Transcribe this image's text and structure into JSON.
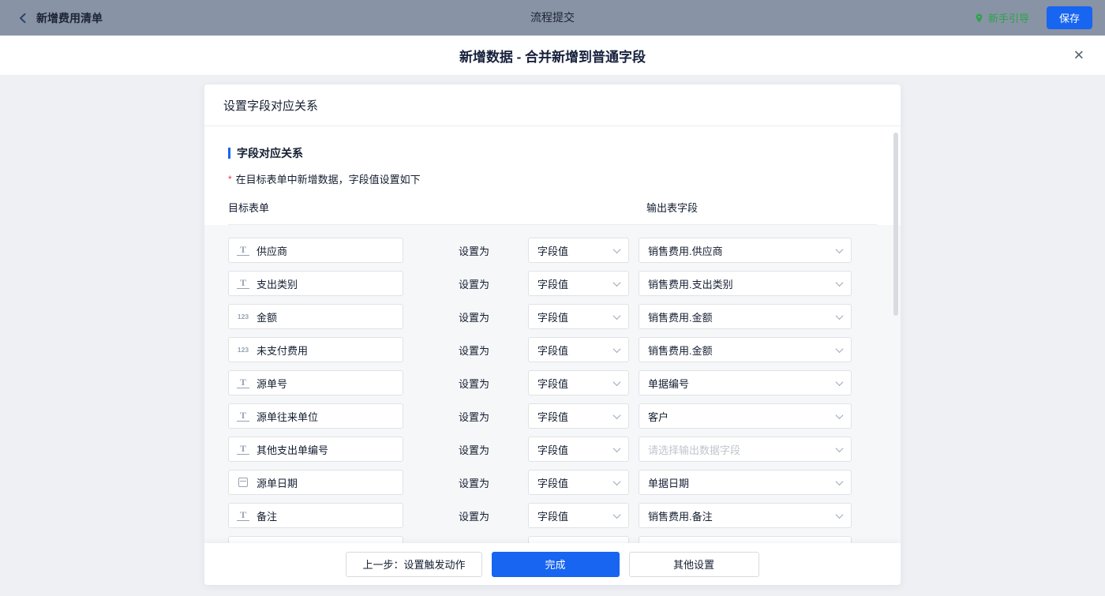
{
  "topbar": {
    "title": "新增费用清单",
    "center_title": "流程提交",
    "guide": "新手引导",
    "save": "保存"
  },
  "modal": {
    "title": "新增数据 - 合并新增到普通字段",
    "close": "✕"
  },
  "panel": {
    "header": "设置字段对应关系",
    "section_title": "字段对应关系",
    "hint_mark": "*",
    "hint": "在目标表单中新增数据，字段值设置如下",
    "columns": {
      "target": "目标表单",
      "output": "输出表字段"
    },
    "set_as_label": "设置为",
    "rows": [
      {
        "icon": "text-field-icon",
        "type": "text",
        "glyph": "T",
        "field": "供应商",
        "mode": "字段值",
        "output": "销售费用.供应商",
        "is_placeholder": false
      },
      {
        "icon": "text-field-icon",
        "type": "text",
        "glyph": "T",
        "field": "支出类别",
        "mode": "字段值",
        "output": "销售费用.支出类别",
        "is_placeholder": false
      },
      {
        "icon": "number-field-icon",
        "type": "number",
        "glyph": "123",
        "field": "金额",
        "mode": "字段值",
        "output": "销售费用.金额",
        "is_placeholder": false
      },
      {
        "icon": "number-field-icon",
        "type": "number",
        "glyph": "123",
        "field": "未支付费用",
        "mode": "字段值",
        "output": "销售费用.金额",
        "is_placeholder": false
      },
      {
        "icon": "text-field-icon",
        "type": "text",
        "glyph": "T",
        "field": "源单号",
        "mode": "字段值",
        "output": "单据编号",
        "is_placeholder": false
      },
      {
        "icon": "text-field-icon",
        "type": "text",
        "glyph": "T",
        "field": "源单往来单位",
        "mode": "字段值",
        "output": "客户",
        "is_placeholder": false
      },
      {
        "icon": "text-field-icon",
        "type": "text",
        "glyph": "T",
        "field": "其他支出单编号",
        "mode": "字段值",
        "output": "请选择输出数据字段",
        "is_placeholder": true
      },
      {
        "icon": "date-field-icon",
        "type": "date",
        "glyph": "",
        "field": "源单日期",
        "mode": "字段值",
        "output": "单据日期",
        "is_placeholder": false
      },
      {
        "icon": "text-field-icon",
        "type": "text",
        "glyph": "T",
        "field": "备注",
        "mode": "字段值",
        "output": "销售费用.备注",
        "is_placeholder": false
      }
    ],
    "footer": {
      "prev": "上一步：设置触发动作",
      "done": "完成",
      "other": "其他设置"
    }
  },
  "colors": {
    "accent_blue": "#1765f0",
    "guide_green": "#2aa547",
    "topbar_bg": "#8893a5",
    "required_red": "#e63746",
    "placeholder_gray": "#c0c4cc"
  }
}
